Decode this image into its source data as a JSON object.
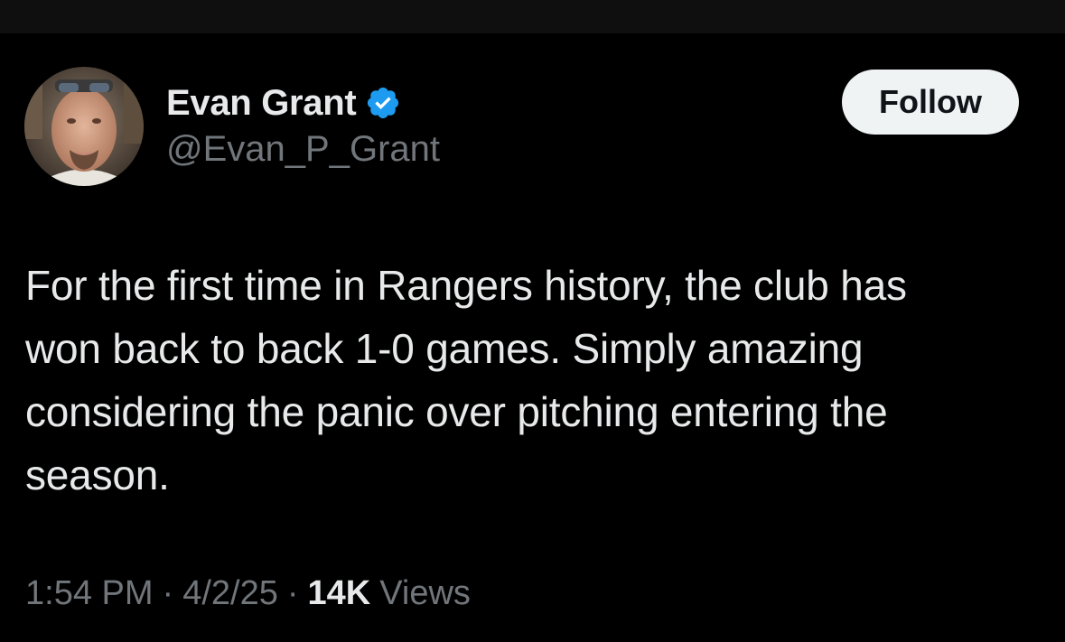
{
  "author": {
    "display_name": "Evan Grant",
    "handle": "@Evan_P_Grant",
    "verified": true,
    "verified_badge_color": "#1d9bf0"
  },
  "actions": {
    "follow_label": "Follow"
  },
  "tweet": {
    "text_lines": [
      "For the first time in Rangers history, the club has",
      "won back to back 1-0 games. Simply amazing",
      "considering the panic over pitching entering the",
      "season."
    ]
  },
  "meta": {
    "time": "1:54 PM",
    "separator": "·",
    "date": "4/2/25",
    "views_count": "14K",
    "views_label": "Views"
  },
  "colors": {
    "background": "#000000",
    "primary_text": "#e7e9ea",
    "secondary_text": "#71767b",
    "follow_button_bg": "#eff3f4"
  }
}
